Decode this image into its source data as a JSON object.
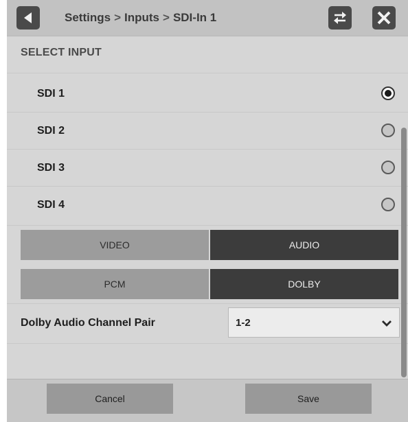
{
  "header": {
    "breadcrumb": [
      "Settings",
      "Inputs",
      "SDI-In 1"
    ],
    "separator": ">"
  },
  "section": {
    "title": "SELECT INPUT"
  },
  "inputs": [
    {
      "label": "SDI 1",
      "selected": true
    },
    {
      "label": "SDI 2",
      "selected": false
    },
    {
      "label": "SDI 3",
      "selected": false
    },
    {
      "label": "SDI 4",
      "selected": false
    }
  ],
  "mode_toggle": {
    "options": [
      "VIDEO",
      "AUDIO"
    ],
    "selected": "AUDIO"
  },
  "format_toggle": {
    "options": [
      "PCM",
      "DOLBY"
    ],
    "selected": "DOLBY"
  },
  "dolby_pair": {
    "label": "Dolby Audio Channel Pair",
    "value": "1-2"
  },
  "footer": {
    "cancel_label": "Cancel",
    "save_label": "Save"
  },
  "icons": {
    "back": "back-arrow-icon",
    "swap": "swap-arrows-icon",
    "close": "close-icon",
    "dropdown": "chevron-down-icon"
  },
  "colors": {
    "selected_segment": "#3c3c3c",
    "unselected_segment": "#9c9c9c",
    "panel": "#d6d6d6"
  }
}
